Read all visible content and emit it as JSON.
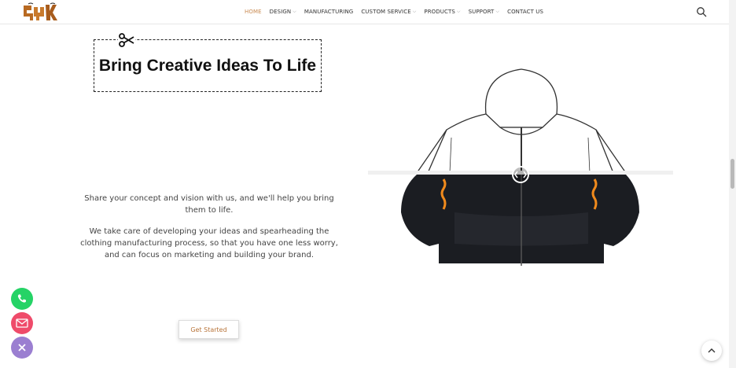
{
  "header": {
    "logo_alt": "logo",
    "nav": [
      {
        "label": "HOME",
        "active": true,
        "dropdown": false
      },
      {
        "label": "DESIGN",
        "active": false,
        "dropdown": true
      },
      {
        "label": "MANUFACTURING",
        "active": false,
        "dropdown": false
      },
      {
        "label": "CUSTOM SERVICE",
        "active": false,
        "dropdown": true
      },
      {
        "label": "PRODUCTS",
        "active": false,
        "dropdown": true
      },
      {
        "label": "SUPPORT",
        "active": false,
        "dropdown": true
      },
      {
        "label": "CONTACT US",
        "active": false,
        "dropdown": false
      }
    ],
    "search_icon": "search-icon"
  },
  "hero": {
    "title": "Bring Creative Ideas To Life",
    "paragraph1": "Share your concept and vision with us, and we'll help you bring them to life.",
    "paragraph2": "We take care of developing your ideas and spearheading the clothing manufacturing process, so that you have one less worry, and can focus on marketing and building your brand.",
    "cta_label": "Get Started"
  },
  "floating": {
    "phone_icon": "phone-icon",
    "mail_icon": "mail-icon",
    "close_icon": "close-icon",
    "scroll_top_icon": "chevron-up-icon"
  },
  "colors": {
    "accent": "#c98b53",
    "phone": "#25d366",
    "mail": "#ef4b6a",
    "close": "#9b7fd1"
  }
}
